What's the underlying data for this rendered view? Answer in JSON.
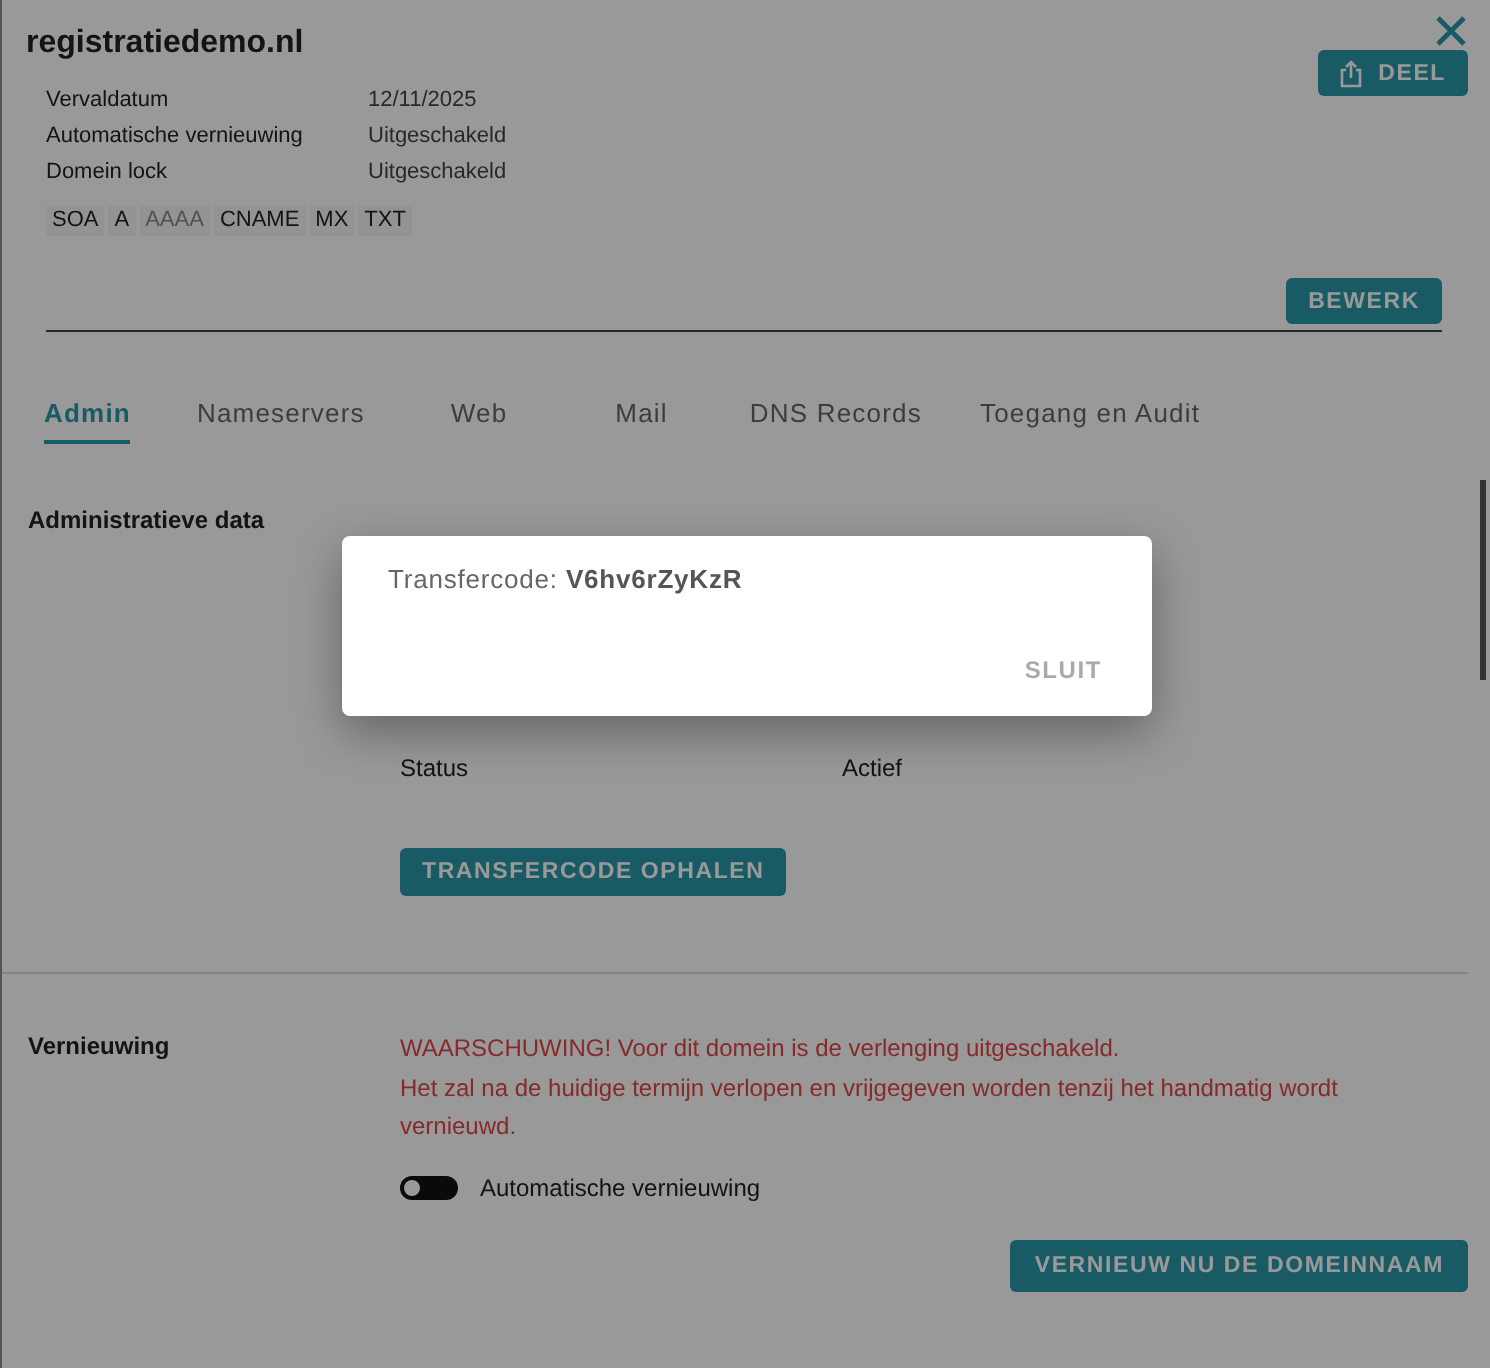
{
  "header": {
    "title": "registratiedemo.nl",
    "share_button": "DEEL"
  },
  "info": [
    {
      "label": "Vervaldatum",
      "value": "12/11/2025"
    },
    {
      "label": "Automatische vernieuwing",
      "value": "Uitgeschakeld"
    },
    {
      "label": "Domein lock",
      "value": "Uitgeschakeld"
    }
  ],
  "record_tags": [
    {
      "label": "SOA",
      "enabled": true
    },
    {
      "label": "A",
      "enabled": true
    },
    {
      "label": "AAAA",
      "enabled": false
    },
    {
      "label": "CNAME",
      "enabled": true
    },
    {
      "label": "MX",
      "enabled": true
    },
    {
      "label": "TXT",
      "enabled": true
    }
  ],
  "edit_button": "BEWERK",
  "tabs": [
    {
      "label": "Admin",
      "selected": true
    },
    {
      "label": "Nameservers",
      "selected": false
    },
    {
      "label": "Web",
      "selected": false
    },
    {
      "label": "Mail",
      "selected": false
    },
    {
      "label": "DNS Records",
      "selected": false
    },
    {
      "label": "Toegang en Audit",
      "selected": false
    }
  ],
  "admin": {
    "title": "Administratieve data",
    "rows": [
      {
        "label": "Status",
        "value": "Actief"
      }
    ],
    "button": "TRANSFERCODE OPHALEN"
  },
  "renewal": {
    "title": "Vernieuwing",
    "warning": [
      "WAARSCHUWING! Voor dit domein is de verlenging uitgeschakeld.",
      "Het zal na de huidige termijn verlopen en vrijgegeven worden tenzij het handmatig wordt vernieuwd."
    ],
    "toggle": {
      "label": "Automatische vernieuwing",
      "on": false
    },
    "button": "VERNIEUW NU DE DOMEINNAAM"
  },
  "dialog": {
    "text": "Transfercode: **V6hv6rZyKzR**",
    "button": "SLUIT"
  }
}
